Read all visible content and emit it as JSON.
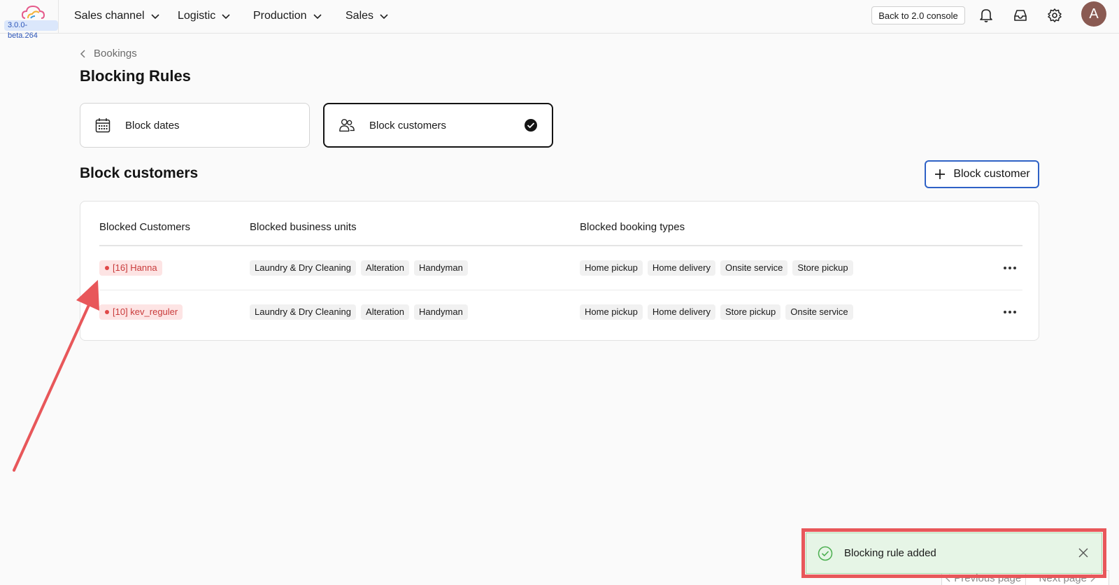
{
  "header": {
    "version": "3.0.0-beta.264",
    "nav": [
      {
        "label": "Sales channel"
      },
      {
        "label": "Logistic"
      },
      {
        "label": "Production"
      },
      {
        "label": "Sales"
      }
    ],
    "console_button": "Back to 2.0 console",
    "avatar_initial": "A"
  },
  "breadcrumb": {
    "label": "Bookings"
  },
  "page_title": "Blocking Rules",
  "cards": [
    {
      "label": "Block dates",
      "icon": "calendar-icon",
      "selected": false
    },
    {
      "label": "Block customers",
      "icon": "users-icon",
      "selected": true
    }
  ],
  "section": {
    "title": "Block customers",
    "add_button": "Block customer"
  },
  "table": {
    "headers": [
      "Blocked Customers",
      "Blocked business units",
      "Blocked booking types"
    ],
    "rows": [
      {
        "customer": "[16] Hanna",
        "units": [
          "Laundry & Dry Cleaning",
          "Alteration",
          "Handyman"
        ],
        "types": [
          "Home pickup",
          "Home delivery",
          "Onsite service",
          "Store pickup"
        ]
      },
      {
        "customer": "[10] kev_reguler",
        "units": [
          "Laundry & Dry Cleaning",
          "Alteration",
          "Handyman"
        ],
        "types": [
          "Home pickup",
          "Home delivery",
          "Store pickup",
          "Onsite service"
        ]
      }
    ]
  },
  "toast": {
    "message": "Blocking rule added"
  },
  "pagination": {
    "previous": "Previous page",
    "next": "Next page"
  },
  "colors": {
    "accent": "#2f62c6",
    "annotation": "#e8575a",
    "toast_bg": "#e6f5e6",
    "badge_bg": "#fde4e4"
  }
}
